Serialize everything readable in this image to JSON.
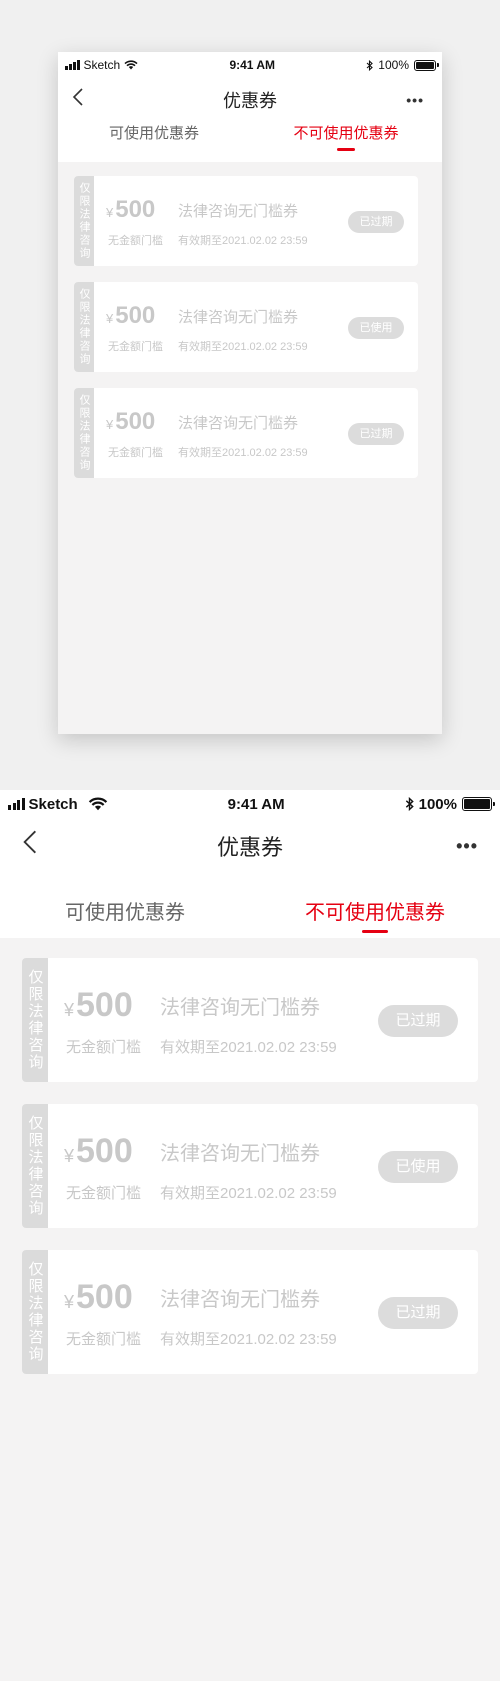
{
  "status_bar": {
    "carrier": "Sketch",
    "time": "9:41 AM",
    "battery": "100%"
  },
  "nav": {
    "title": "优惠券",
    "back_icon": "chevron-left-icon",
    "more_icon": "more-dots-icon"
  },
  "tabs": [
    {
      "label": "可使用优惠券",
      "active": false
    },
    {
      "label": "不可使用优惠券",
      "active": true
    }
  ],
  "coupons": [
    {
      "side_tag": "仅限法律咨询",
      "currency": "¥",
      "amount": "500",
      "name": "法律咨询无门槛券",
      "threshold": "无金额门槛",
      "validity": "有效期至2021.02.02 23:59",
      "status": "已过期"
    },
    {
      "side_tag": "仅限法律咨询",
      "currency": "¥",
      "amount": "500",
      "name": "法律咨询无门槛券",
      "threshold": "无金额门槛",
      "validity": "有效期至2021.02.02 23:59",
      "status": "已使用"
    },
    {
      "side_tag": "仅限法律咨询",
      "currency": "¥",
      "amount": "500",
      "name": "法律咨询无门槛券",
      "threshold": "无金额门槛",
      "validity": "有效期至2021.02.02 23:59",
      "status": "已过期"
    }
  ],
  "colors": {
    "accent": "#e50012",
    "muted_text": "#c8c8c8",
    "background": "#f4f3f3"
  }
}
